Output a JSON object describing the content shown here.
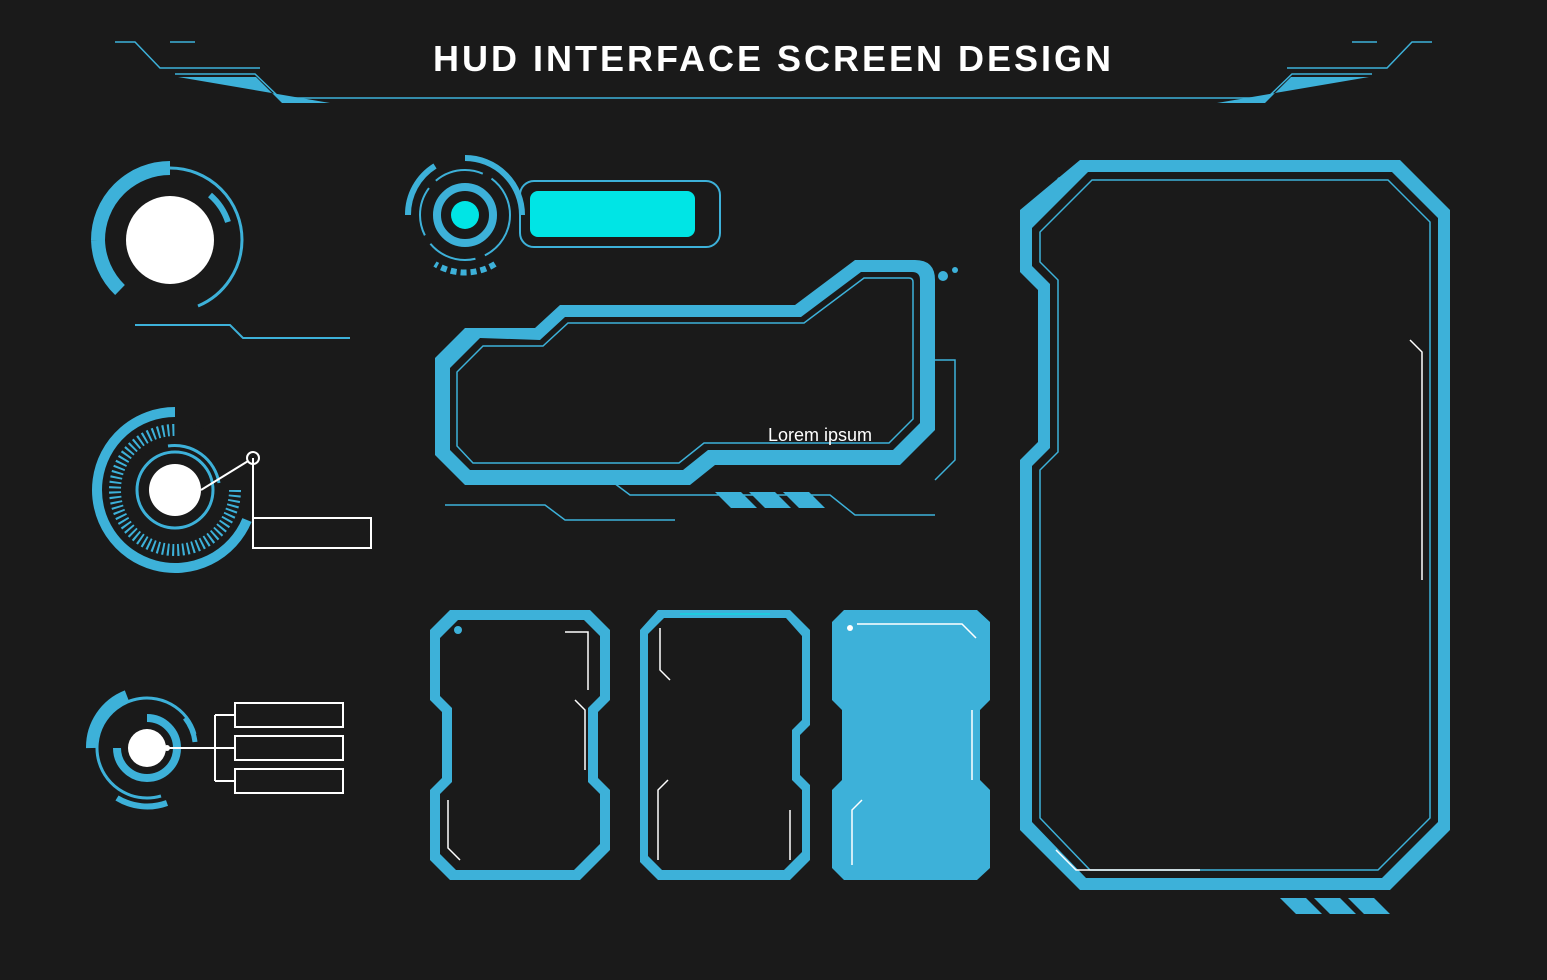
{
  "title": "HUD INTERFACE SCREEN DESIGN",
  "panel_wide": {
    "label": "Lorem ipsum"
  },
  "colors": {
    "accent": "#3db1d9",
    "accent_bright": "#00e5e5",
    "white": "#ffffff",
    "bg": "#1a1a1a"
  },
  "elements": {
    "header_decoration_left": "angular-bracket",
    "header_decoration_right": "angular-bracket",
    "circular_gauge_1": "white-core-ring",
    "circular_gauge_2": "tick-ring-callout",
    "circular_gauge_3": "triple-label-ring",
    "status_pill": "cyan-button",
    "panel_wide": "angular-frame",
    "panel_small_1": "portrait-frame",
    "panel_small_2": "portrait-frame",
    "panel_small_3": "portrait-frame",
    "panel_large": "tall-frame"
  }
}
